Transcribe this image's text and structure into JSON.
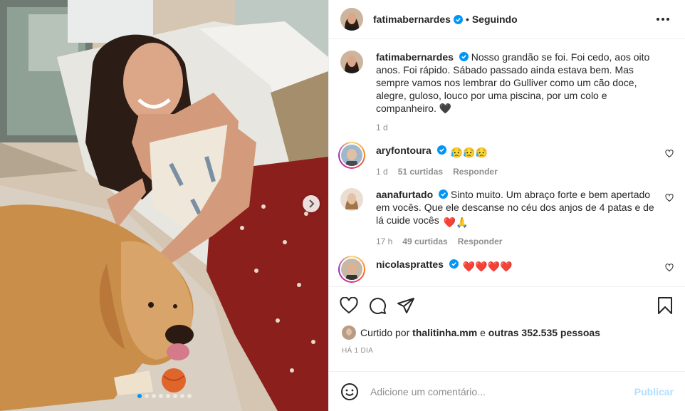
{
  "post": {
    "author": "fatimabernardes",
    "follow_state": "Seguindo",
    "separator": "•",
    "caption": "Nosso grandão se foi. Foi cedo, aos oito anos. Foi rápido. Sábado passado ainda estava bem. Mas sempre vamos nos lembrar do Gulliver como um cão doce, alegre, guloso, louco por uma piscina, por um colo e companheiro.",
    "caption_emoji": "🖤",
    "caption_time": "1 d"
  },
  "comments": [
    {
      "user": "aryfontoura",
      "text": "",
      "emoji": "😥😥😥",
      "time": "1 d",
      "likes": "51 curtidas",
      "reply": "Responder"
    },
    {
      "user": "aanafurtado",
      "text": "Sinto muito. Um abraço forte e bem apertado em vocês. Que ele descanse no céu dos anjos de 4 patas e de lá cuide vocês",
      "emoji": "❤️🙏",
      "time": "17 h",
      "likes": "49 curtidas",
      "reply": "Responder"
    },
    {
      "user": "nicolasprattes",
      "text": "",
      "emoji": "❤️❤️❤️❤️"
    }
  ],
  "likes": {
    "prefix": "Curtido por",
    "user": "thalitinha.mm",
    "middle": "e",
    "others": "outras 352.535 pessoas"
  },
  "timestamp": "HÁ 1 DIA",
  "add_comment": {
    "placeholder": "Adicione um comentário...",
    "publish": "Publicar"
  },
  "carousel": {
    "slides": 8,
    "active_index": 0
  },
  "colors": {
    "verified": "#0095f6",
    "publish_disabled": "#b2dffc",
    "meta": "#8e8e8e"
  },
  "icons": [
    "heart-icon",
    "comment-icon",
    "share-icon",
    "bookmark-icon",
    "more-options-icon",
    "emoji-icon",
    "chevron-right-icon",
    "verified-icon"
  ]
}
